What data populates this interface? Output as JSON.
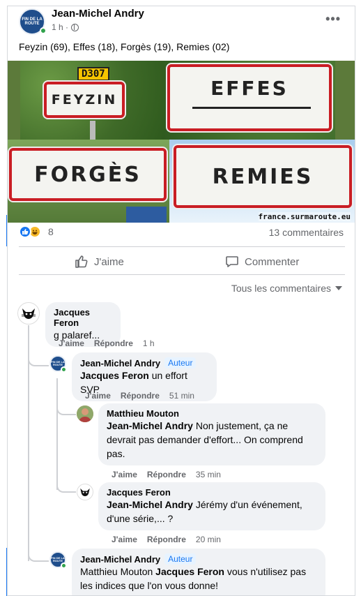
{
  "post": {
    "author": "Jean-Michel Andry",
    "time": "1 h ·",
    "avatar_text": "FIN DE LA ROUTE",
    "text": "Feyzin (69), Effes (18), Forgès (19), Remies (02)",
    "more": "•••"
  },
  "photo": {
    "plate": "D307",
    "signs": [
      "FEYZIN",
      "EFFES",
      "FORGÈS",
      "REMIES"
    ],
    "watermark": "france.surmaroute.eu"
  },
  "stats": {
    "reaction_count": "8",
    "comments": "13 commentaires"
  },
  "actions": {
    "like": "J'aime",
    "comment": "Commenter",
    "all_comments": "Tous les commentaires"
  },
  "comments": [
    {
      "author": "Jacques Feron",
      "text": "g palaref...",
      "like": "J'aime",
      "reply": "Répondre",
      "time": "1 h"
    },
    {
      "author": "Jean-Michel Andry",
      "badge": "Auteur",
      "mention": "Jacques Feron",
      "text": " un effort SVP",
      "like": "J'aime",
      "reply": "Répondre",
      "time": "51 min"
    },
    {
      "author": "Matthieu Mouton",
      "mention": "Jean-Michel Andry",
      "text": " Non justement, ça ne devrait pas demander d'effort... On comprend pas.",
      "like": "J'aime",
      "reply": "Répondre",
      "time": "35 min"
    },
    {
      "author": "Jacques Feron",
      "mention": "Jean-Michel Andry",
      "text": " Jérémy d'un événement, d'une série,... ?",
      "like": "J'aime",
      "reply": "Répondre",
      "time": "20 min"
    },
    {
      "author": "Jean-Michel Andry",
      "badge": "Auteur",
      "prefix": "Matthieu Mouton ",
      "mention": "Jacques Feron",
      "text": " vous n'utilisez pas les indices que l'on vous donne!"
    }
  ],
  "colors": {
    "accent": "#1877f2",
    "sign_border": "#c91d24",
    "online": "#31a24c"
  }
}
